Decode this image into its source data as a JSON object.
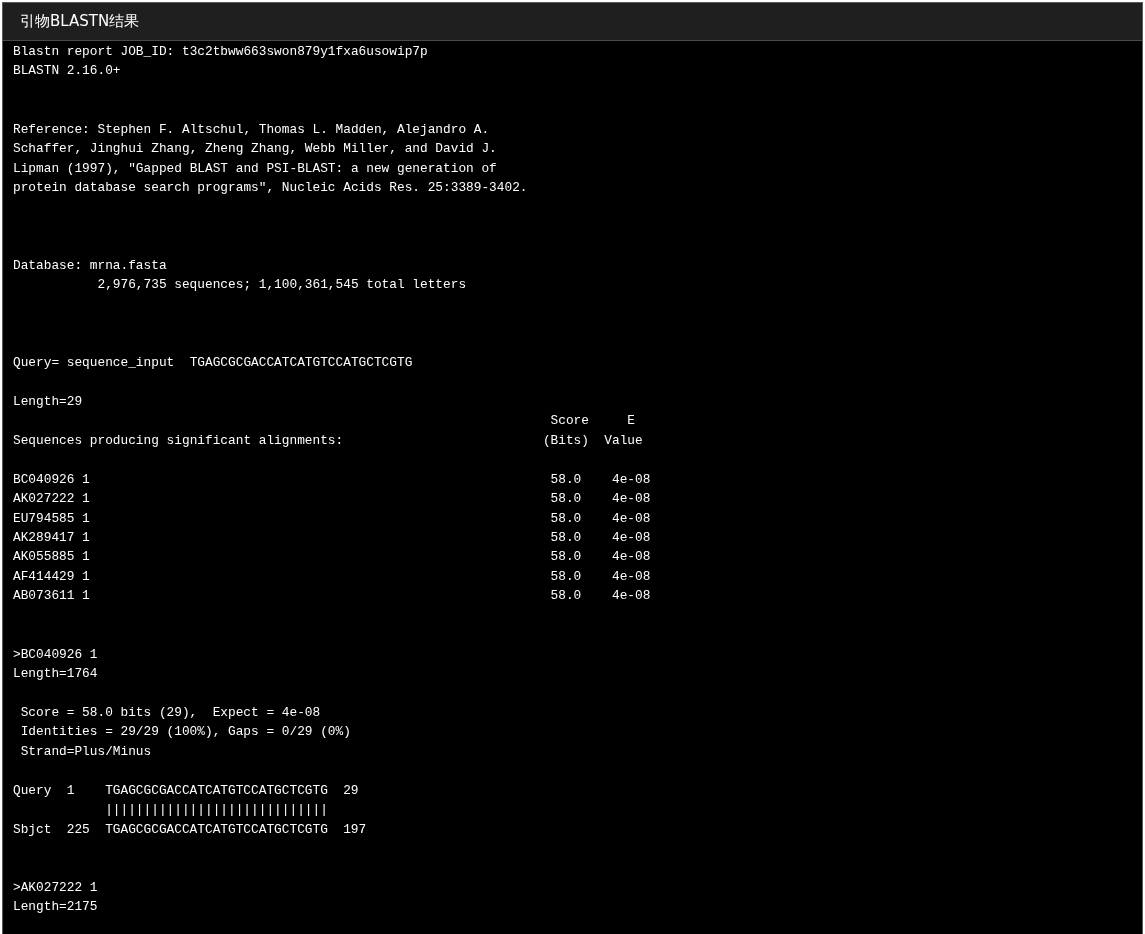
{
  "panel": {
    "title": "引物BLASTN结果"
  },
  "report": {
    "job_line": "Blastn report JOB_ID: t3c2tbww663swon879y1fxa6usowip7p",
    "version": "BLASTN 2.16.0+",
    "reference": [
      "Reference: Stephen F. Altschul, Thomas L. Madden, Alejandro A.",
      "Schaffer, Jinghui Zhang, Zheng Zhang, Webb Miller, and David J.",
      "Lipman (1997), \"Gapped BLAST and PSI-BLAST: a new generation of",
      "protein database search programs\", Nucleic Acids Res. 25:3389-3402."
    ],
    "database": {
      "name_line": "Database: mrna.fasta",
      "stats": "2,976,735 sequences; 1,100,361,545 total letters"
    },
    "query": {
      "line": "Query= sequence_input  TGAGCGCGACCATCATGTCCATGCTCGTG",
      "length": "Length=29"
    },
    "hits": {
      "title": "Sequences producing significant alignments:",
      "score_header": [
        "Score",
        "(Bits)"
      ],
      "evalue_header": [
        "E",
        "Value"
      ],
      "rows": [
        {
          "id": "BC040926 1",
          "score": "58.0",
          "evalue": "4e-08"
        },
        {
          "id": "AK027222 1",
          "score": "58.0",
          "evalue": "4e-08"
        },
        {
          "id": "EU794585 1",
          "score": "58.0",
          "evalue": "4e-08"
        },
        {
          "id": "AK289417 1",
          "score": "58.0",
          "evalue": "4e-08"
        },
        {
          "id": "AK055885 1",
          "score": "58.0",
          "evalue": "4e-08"
        },
        {
          "id": "AF414429 1",
          "score": "58.0",
          "evalue": "4e-08"
        },
        {
          "id": "AB073611 1",
          "score": "58.0",
          "evalue": "4e-08"
        }
      ]
    },
    "alignments": [
      {
        "title": ">BC040926 1",
        "length": "Length=1764",
        "stats": [
          "Score = 58.0 bits (29),  Expect = 4e-08",
          "Identities = 29/29 (100%), Gaps = 0/29 (0%)",
          "Strand=Plus/Minus"
        ],
        "query_row": {
          "label": "Query",
          "start": "1",
          "sequence": "TGAGCGCGACCATCATGTCCATGCTCGTG",
          "end": "29"
        },
        "match": "|||||||||||||||||||||||||||||",
        "sbjct_row": {
          "label": "Sbjct",
          "start": "225",
          "sequence": "TGAGCGCGACCATCATGTCCATGCTCGTG",
          "end": "197"
        }
      },
      {
        "title": ">AK027222 1",
        "length": "Length=2175"
      }
    ]
  }
}
